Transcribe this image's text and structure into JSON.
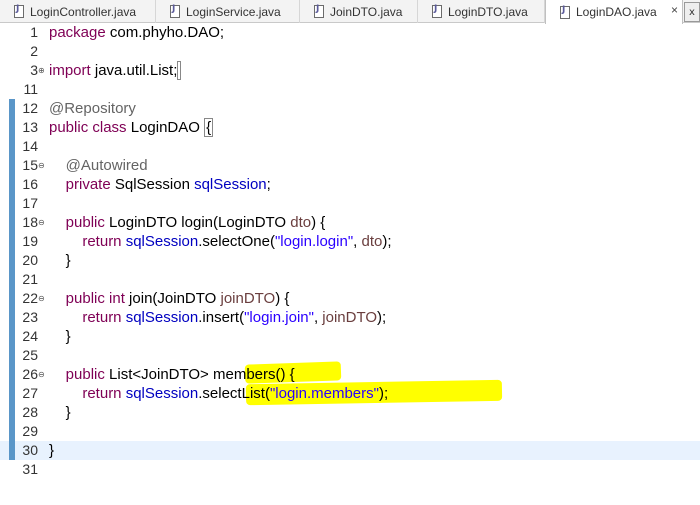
{
  "tabs": [
    {
      "label": "LoginController.java"
    },
    {
      "label": "LoginService.java"
    },
    {
      "label": "JoinDTO.java"
    },
    {
      "label": "LoginDTO.java"
    },
    {
      "label": "LoginDAO.java",
      "active": true,
      "close": "×"
    }
  ],
  "tab_overflow": "x",
  "editor": {
    "lines": [
      {
        "n": "1"
      },
      {
        "n": "2"
      },
      {
        "n": "3"
      },
      {
        "n": "11"
      },
      {
        "n": "12"
      },
      {
        "n": "13"
      },
      {
        "n": "14"
      },
      {
        "n": "15"
      },
      {
        "n": "16"
      },
      {
        "n": "17"
      },
      {
        "n": "18"
      },
      {
        "n": "19"
      },
      {
        "n": "20"
      },
      {
        "n": "21"
      },
      {
        "n": "22"
      },
      {
        "n": "23"
      },
      {
        "n": "24"
      },
      {
        "n": "25"
      },
      {
        "n": "26"
      },
      {
        "n": "27"
      },
      {
        "n": "28"
      },
      {
        "n": "29"
      },
      {
        "n": "30"
      },
      {
        "n": "31"
      }
    ],
    "tokens": {
      "package": "package",
      "pkg_name": " com.phyho.DAO;",
      "import": "import",
      "import_name": " java.util.List;",
      "repository": "@Repository",
      "public": "public",
      "class": "class",
      "class_name": " LoginDAO ",
      "open_brace": "{",
      "autowired": "@Autowired",
      "private": "private",
      "sqlsession_type": " SqlSession ",
      "sqlsession_field": "sqlSession",
      "semicolon": ";",
      "login_sig_1": " LoginDTO login(LoginDTO ",
      "dto": "dto",
      "sig_end": ") {",
      "return": "return",
      "select_one_call": ".selectOne(",
      "str_login_login": "\"login.login\"",
      "comma_sp": ", ",
      "call_end": ");",
      "close_brace": "}",
      "int": "int",
      "join_sig_1": " join(JoinDTO ",
      "joinDTO": "joinDTO",
      "insert_call": ".insert(",
      "str_login_join": "\"login.join\"",
      "members_sig_1": " List<JoinDTO>",
      "members_sig_2": " members() {",
      "select_list_call": ".selectList(",
      "str_login_members": "\"login.members\"",
      "fold_minus": "⊖",
      "fold_plus": "⊕"
    }
  }
}
